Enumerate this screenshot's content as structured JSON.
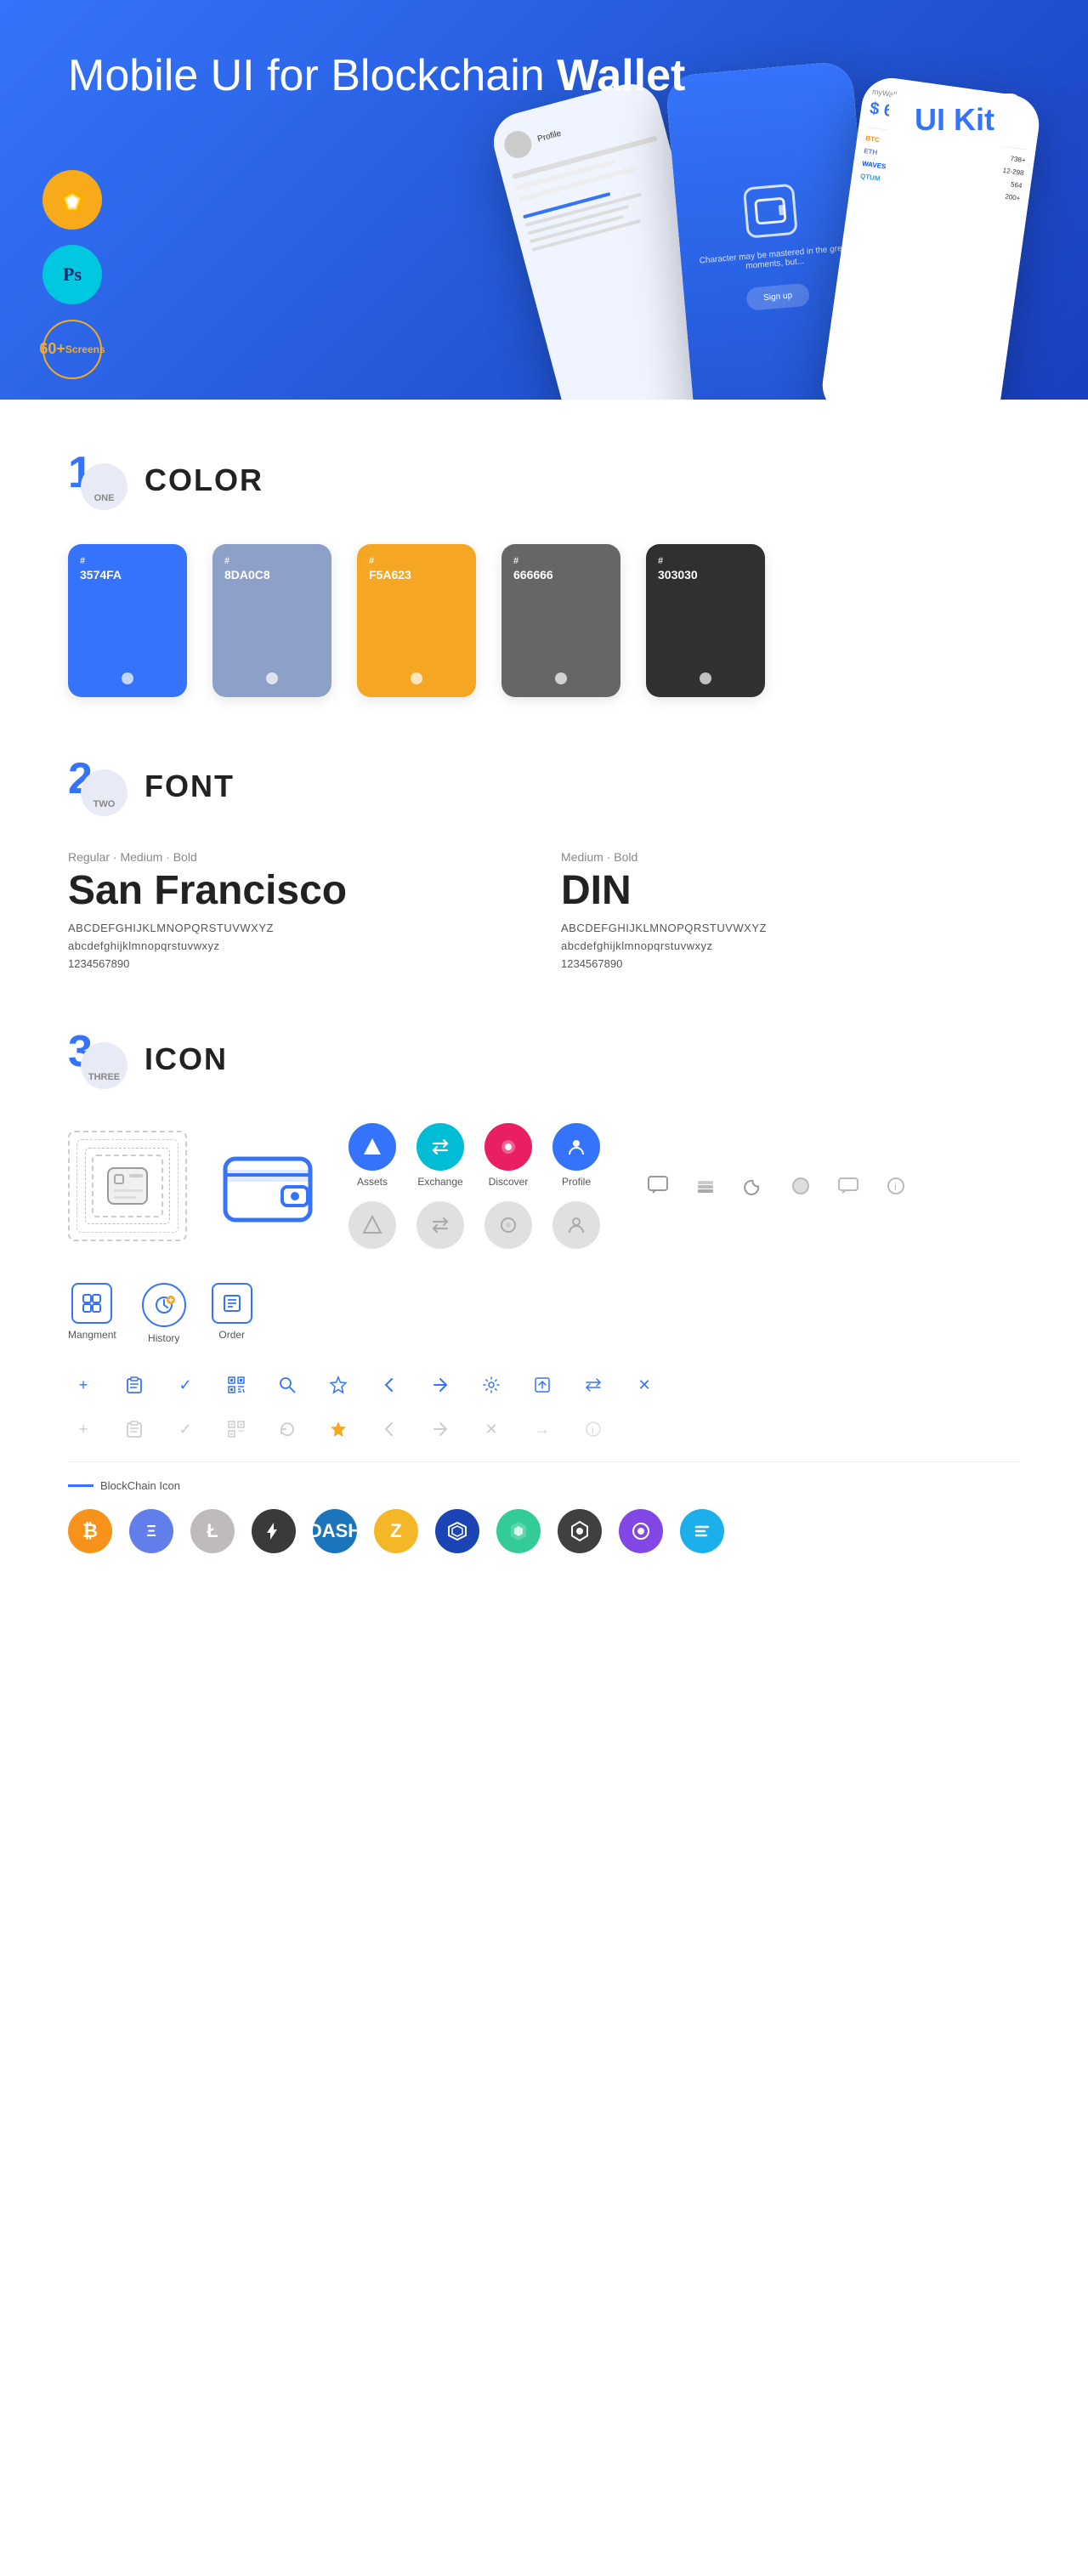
{
  "hero": {
    "title_regular": "Mobile UI for Blockchain ",
    "title_bold": "Wallet",
    "badge": "UI Kit",
    "tools": [
      {
        "name": "Sketch",
        "bg": "sketch"
      },
      {
        "name": "Photoshop",
        "bg": "ps"
      }
    ],
    "screens_badge": "60+\nScreens"
  },
  "sections": {
    "color": {
      "num": "1",
      "label": "ONE",
      "title": "COLOR",
      "swatches": [
        {
          "hex": "#3574FA",
          "label": "#\n3574FA",
          "bottom_bg": "#1f55d6"
        },
        {
          "hex": "#8DA0C8",
          "label": "#\n8DA0C8",
          "bottom_bg": "#6d85b0"
        },
        {
          "hex": "#F5A623",
          "label": "#\nF5A623",
          "bottom_bg": "#d4880e"
        },
        {
          "hex": "#666666",
          "label": "#\n666666",
          "bottom_bg": "#444"
        },
        {
          "hex": "#303030",
          "label": "#\n303030",
          "bottom_bg": "#111"
        }
      ]
    },
    "font": {
      "num": "2",
      "label": "TWO",
      "title": "FONT",
      "fonts": [
        {
          "meta": "Regular · Medium · Bold",
          "name": "San Francisco",
          "uppercase": "ABCDEFGHIJKLMNOPQRSTUVWXYZ",
          "lowercase": "abcdefghijklmnopqrstuvwxyz",
          "numbers": "1234567890",
          "style": "normal"
        },
        {
          "meta": "Medium · Bold",
          "name": "DIN",
          "uppercase": "ABCDEFGHIJKLMNOPQRSTUVWXYZ",
          "lowercase": "abcdefghijklmnopqrstuvwxyz",
          "numbers": "1234567890",
          "style": "din"
        }
      ]
    },
    "icon": {
      "num": "3",
      "label": "THREE",
      "title": "ICON",
      "nav_icons": [
        {
          "label": "Assets",
          "symbol": "◆"
        },
        {
          "label": "Exchange",
          "symbol": "⇄"
        },
        {
          "label": "Discover",
          "symbol": "◉"
        },
        {
          "label": "Profile",
          "symbol": "⌂"
        }
      ],
      "bottom_icons": [
        {
          "label": "Mangment",
          "type": "sq"
        },
        {
          "label": "History",
          "type": "circle-clock"
        },
        {
          "label": "Order",
          "type": "sq-list"
        }
      ],
      "utility_icons_colored": [
        "💬",
        "≡",
        "☽",
        "●",
        "💬",
        "ℹ"
      ],
      "utility_icons_row1": [
        "+",
        "📋",
        "✓",
        "⊞",
        "🔍",
        "☆",
        "<",
        "⇡",
        "⚙",
        "⊡",
        "⇔",
        "✕"
      ],
      "utility_icons_row2": [
        "+",
        "📋",
        "✓",
        "⊞",
        "↻",
        "☆",
        "<",
        "⇡",
        "✕",
        "→",
        "ℹ"
      ],
      "blockchain_label": "BlockChain Icon",
      "crypto": [
        {
          "symbol": "₿",
          "name": "Bitcoin",
          "class": "ci-btc"
        },
        {
          "symbol": "Ξ",
          "name": "Ethereum",
          "class": "ci-eth"
        },
        {
          "symbol": "Ł",
          "name": "Litecoin",
          "class": "ci-ltc"
        },
        {
          "symbol": "◈",
          "name": "Feather",
          "class": "ci-dash"
        },
        {
          "symbol": "Ð",
          "name": "Dash",
          "class": "ci-dash"
        },
        {
          "symbol": "Z",
          "name": "Zcash",
          "class": "ci-zcash"
        },
        {
          "symbol": "⬡",
          "name": "Waves",
          "class": "ci-waves"
        },
        {
          "symbol": "△",
          "name": "Lisk",
          "class": "ci-lisk"
        },
        {
          "symbol": "◈",
          "name": "Qtum",
          "class": "ci-qtum"
        },
        {
          "symbol": "◆",
          "name": "Polygon",
          "class": "ci-poly"
        },
        {
          "symbol": "⬡",
          "name": "Stratis",
          "class": "ci-stratis"
        }
      ]
    }
  }
}
